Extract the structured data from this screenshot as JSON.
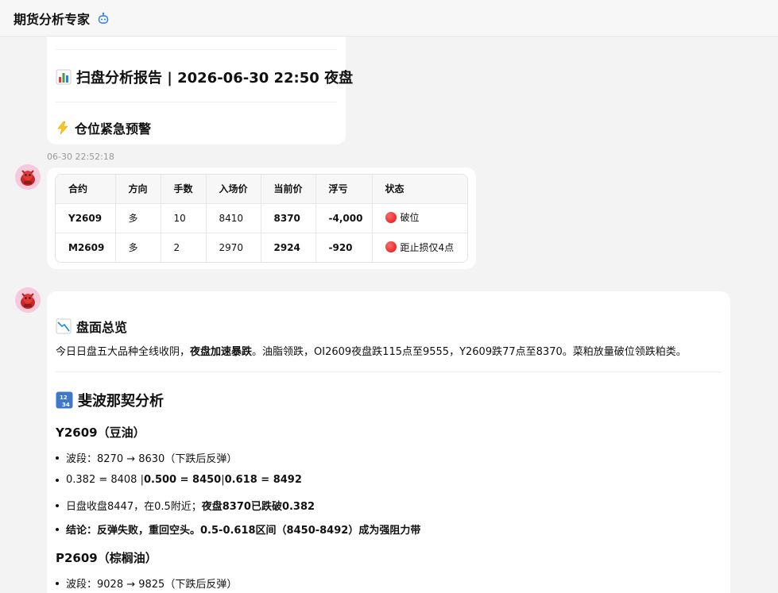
{
  "header": {
    "app_title": "期货分析专家",
    "bot_icon": "robot-icon"
  },
  "msg1": {
    "report_title": "扫盘分析报告 | 2026-06-30 22:50 夜盘",
    "report_icon": "bar-chart-emoji",
    "alert_title": "仓位紧急预警",
    "alert_icon": "lightning-emoji"
  },
  "timestamp": "06-30 22:52:18",
  "positions": {
    "headers": [
      "合约",
      "方向",
      "手数",
      "入场价",
      "当前价",
      "浮亏",
      "状态"
    ],
    "rows": [
      {
        "contract": "Y2609",
        "direction": "多",
        "lots": "10",
        "entry": "8410",
        "current": "8370",
        "pnl": "-4,000",
        "status": "破位"
      },
      {
        "contract": "M2609",
        "direction": "多",
        "lots": "2",
        "entry": "2970",
        "current": "2924",
        "pnl": "-920",
        "status": "距止损仅4点"
      }
    ],
    "status_color": "#dd1111"
  },
  "msg3": {
    "overview_title": "盘面总览",
    "overview_icon": "chart-decreasing-emoji",
    "overview_text_a": "今日日盘五大品种全线收阴，",
    "overview_text_bold": "夜盘加速暴跌",
    "overview_text_b": "。油脂领跌，OI2609夜盘跌115点至9555，Y2609跌77点至8370。菜粕放量破位领跌粕类。",
    "fib_title": "斐波那契分析",
    "fib_icon": "numbers-emoji",
    "y_title": "Y2609（豆油）",
    "y_items": {
      "i1": "波段：8270 → 8630（下跌后反弹）",
      "i2_a": "0.382 = 8408 | ",
      "i2_b": "0.500 = 8450",
      "i2_c": "| ",
      "i2_d": "0.618 = 8492",
      "i3_a": "日盘收盘8447，在0.5附近；",
      "i3_b": "夜盘8370已跌破0.382",
      "i4_a": "结论：反弹失败，重回空头。",
      "i4_b": "0.5-0.618区间（8450-8492）成为强阻力带"
    },
    "p_title": "P2609（棕榈油）",
    "p_items": {
      "i1": "波段：9028 → 9825（下跌后反弹）"
    }
  }
}
